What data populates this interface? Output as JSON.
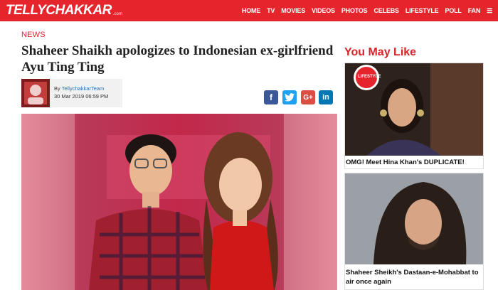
{
  "header": {
    "logo_text": "TELLYCHAKKAR",
    "logo_suffix": ".com",
    "nav": [
      "HOME",
      "TV",
      "MOVIES",
      "VIDEOS",
      "PHOTOS",
      "CELEBS",
      "LIFESTYLE",
      "POLL",
      "FAN",
      "☰"
    ]
  },
  "article": {
    "section": "NEWS",
    "title": "Shaheer Shaikh apologizes to Indonesian ex-girlfriend Ayu Ting Ting",
    "by_prefix": "By ",
    "author": "TellychakkarTeam",
    "date": "30 Mar 2019 06:59 PM"
  },
  "share": {
    "facebook": "f",
    "twitter": "t",
    "googleplus": "G+",
    "linkedin": "in"
  },
  "sidebar": {
    "heading": "You May Like",
    "cards": [
      {
        "caption": "OMG! Meet Hina Khan's DUPLICATE!",
        "badge": "LIFESTYLE"
      },
      {
        "caption": "Shaheer Sheikh's Dastaan-e-Mohabbat to air once again"
      }
    ]
  },
  "colors": {
    "brand": "#e5242b",
    "link": "#2a6fb1"
  }
}
